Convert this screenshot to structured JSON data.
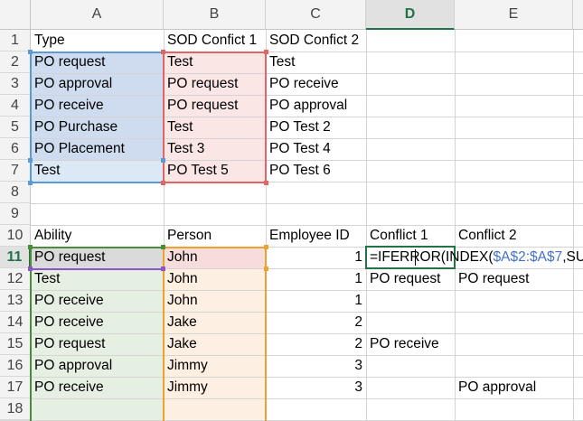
{
  "columns": [
    "A",
    "B",
    "C",
    "D",
    "E"
  ],
  "active_column": "D",
  "rows": [
    "1",
    "2",
    "3",
    "4",
    "5",
    "6",
    "7",
    "8",
    "9",
    "10",
    "11",
    "12",
    "13",
    "14",
    "15",
    "16",
    "17",
    "18"
  ],
  "active_row": "11",
  "cells": {
    "A1": "Type",
    "B1": "SOD Confict 1",
    "C1": "SOD Confict 2",
    "A2": "PO request",
    "B2": "Test",
    "C2": "Test",
    "A3": "PO approval",
    "B3": "PO request",
    "C3": "PO receive",
    "A4": "PO receive",
    "B4": "PO request",
    "C4": "PO approval",
    "A5": "PO Purchase",
    "B5": "Test",
    "C5": "PO Test 2",
    "A6": "PO Placement",
    "B6": "Test 3",
    "C6": "PO Test 4",
    "A7": "Test",
    "B7": "PO Test 5",
    "C7": "PO Test 6",
    "A10": "Ability",
    "B10": "Person",
    "C10": "Employee ID",
    "D10": "Conflict 1",
    "E10": "Conflict 2",
    "A11": "PO request",
    "B11": "John",
    "C11": "1",
    "A12": "Test",
    "B12": "John",
    "C12": "1",
    "D12": "PO request",
    "E12": "PO request",
    "A13": "PO receive",
    "B13": "John",
    "C13": "1",
    "A14": "PO receive",
    "B14": "Jake",
    "C14": "2",
    "A15": "PO request",
    "B15": "Jake",
    "C15": "2",
    "D15": "PO receive",
    "A16": "PO approval",
    "B16": "Jimmy",
    "C16": "3",
    "A17": "PO receive",
    "B17": "Jimmy",
    "C17": "3",
    "E17": "PO approval"
  },
  "editing_formula": {
    "part1": "=IFERROR(INDEX(",
    "ref": "$A$2:$A$7",
    "part2": ",SUM"
  },
  "colors": {
    "range_blue": "#5b9bd5",
    "range_red": "#e06666",
    "range_green": "#4a8c3a",
    "range_orange": "#f0a030",
    "range_purple": "#8a56c8",
    "active_green": "#217346"
  }
}
